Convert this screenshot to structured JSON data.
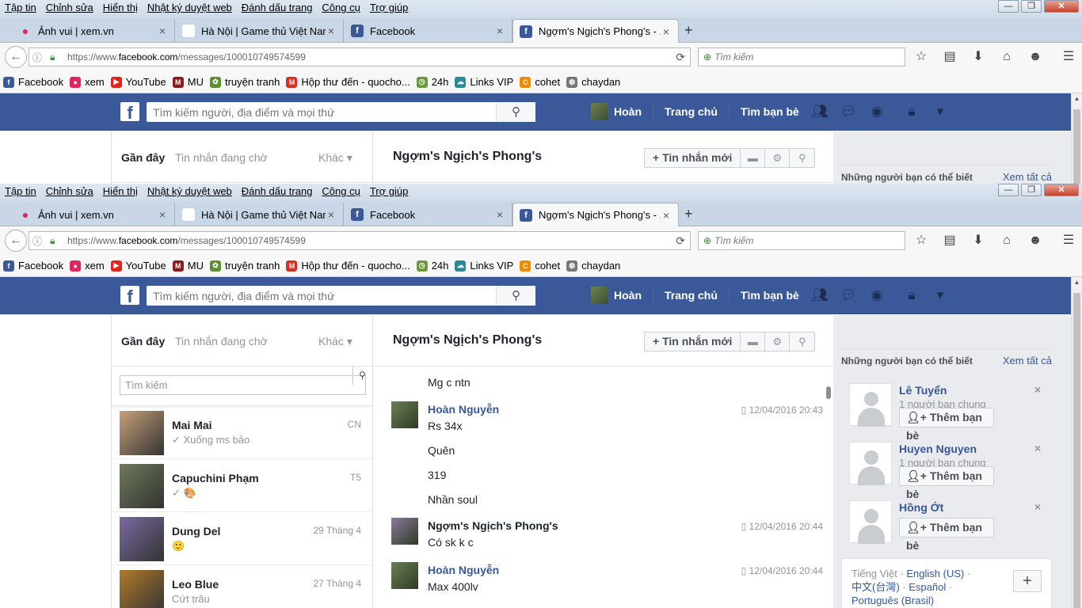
{
  "menu": [
    "Tập tin",
    "Chỉnh sửa",
    "Hiển thị",
    "Nhật ký duyệt web",
    "Đánh dấu trang",
    "Công cụ",
    "Trợ giúp"
  ],
  "window_controls": {
    "minimize": "—",
    "maximize": "❐",
    "close": "✕"
  },
  "tabs": [
    {
      "label": "Ảnh vui | xem.vn",
      "icon": "xem-icon",
      "color": "#e0245e"
    },
    {
      "label": "Hà Nội | Game thủ Việt Nam- ...",
      "icon": "blank-icon",
      "color": "#ffffff"
    },
    {
      "label": "Facebook",
      "icon": "facebook-icon",
      "color": "#3b5998"
    },
    {
      "label": "Ngợm's Ngịch's Phong's - ...",
      "icon": "facebook-icon",
      "color": "#3b5998"
    }
  ],
  "new_tab_label": "+",
  "address": {
    "prefix": "https://www.",
    "domain": "facebook.com",
    "path": "/messages/100010749574599"
  },
  "browser_search": {
    "placeholder": "Tìm kiếm"
  },
  "bookmarks": [
    {
      "label": "Facebook",
      "icon": "facebook-icon",
      "color": "#3b5998",
      "glyph": "f"
    },
    {
      "label": "xem",
      "icon": "xem-icon",
      "color": "#e0245e",
      "glyph": "●"
    },
    {
      "label": "YouTube",
      "icon": "youtube-icon",
      "color": "#e62117",
      "glyph": "▶"
    },
    {
      "label": "MU",
      "icon": "mu-icon",
      "color": "#8b1a1a",
      "glyph": "M"
    },
    {
      "label": "truyện tranh",
      "icon": "leaf-icon",
      "color": "#5b8f2f",
      "glyph": "✿"
    },
    {
      "label": "Hộp thư đến - quocho...",
      "icon": "gmail-icon",
      "color": "#d93025",
      "glyph": "M"
    },
    {
      "label": "24h",
      "icon": "clock-icon",
      "color": "#6a9a3b",
      "glyph": "◷"
    },
    {
      "label": "Links VIP",
      "icon": "cloud-icon",
      "color": "#2a8a96",
      "glyph": "☁"
    },
    {
      "label": "cohet",
      "icon": "c-icon",
      "color": "#f08a00",
      "glyph": "C"
    },
    {
      "label": "chaydan",
      "icon": "globe-icon",
      "color": "#777777",
      "glyph": "◍"
    }
  ],
  "fb": {
    "logo": "f",
    "search_placeholder": "Tìm kiếm người, địa điểm và mọi thứ",
    "user": "Hoàn",
    "home": "Trang chủ",
    "find_friends": "Tìm bạn bè"
  },
  "left": {
    "recent": "Gần đây",
    "pending": "Tin nhắn đang chờ",
    "other": "Khác",
    "search_placeholder": "Tìm kiếm",
    "threads": [
      {
        "name": "Mai Mai",
        "snippet": "Xuống ms bảo",
        "time": "CN",
        "pic": "#c8a07a"
      },
      {
        "name": "Capuchini Phạm",
        "snippet": "🎨",
        "time": "T5",
        "pic": "#6d7a5a"
      },
      {
        "name": "Dung Del",
        "snippet": "🙂",
        "time": "29 Tháng 4",
        "pic": "#7a6aa0"
      },
      {
        "name": "Leo Blue",
        "snippet": "Cứt trâu",
        "time": "27 Tháng 4",
        "pic": "#b07a2a"
      }
    ]
  },
  "conversation": {
    "title": "Ngợm's Ngịch's Phong's",
    "new_message": "Tin nhắn mới",
    "messages_top": "Mg c ntn",
    "blocks": [
      {
        "sender": "Hoàn Nguyễn",
        "time": "12/04/2016 20:43",
        "lines": [
          "Rs 34x",
          "Quên",
          "319",
          "Nhần soul"
        ],
        "me": true
      },
      {
        "sender": "Ngợm's Ngịch's Phong's",
        "time": "12/04/2016 20:44",
        "lines": [
          "Có sk k c"
        ],
        "me": false
      },
      {
        "sender": "Hoàn Nguyễn",
        "time": "12/04/2016 20:44",
        "lines": [
          "Max 400lv"
        ],
        "me": true
      }
    ]
  },
  "right": {
    "heading": "Những người bạn có thể biết",
    "see_all": "Xem tất cả",
    "people": [
      {
        "name": "Lê Tuyển",
        "mutual": "1 người bạn chung",
        "button": "Thêm bạn bè"
      },
      {
        "name": "Huyen Nguyen",
        "mutual": "1 người bạn chung",
        "button": "Thêm bạn bè"
      },
      {
        "name": "Hồng Ớt",
        "mutual": "",
        "button": "Thêm bạn bè"
      }
    ],
    "languages": [
      "Tiếng Việt",
      "English (US)",
      "中文(台灣)",
      "Español",
      "Português (Brasil)"
    ]
  }
}
